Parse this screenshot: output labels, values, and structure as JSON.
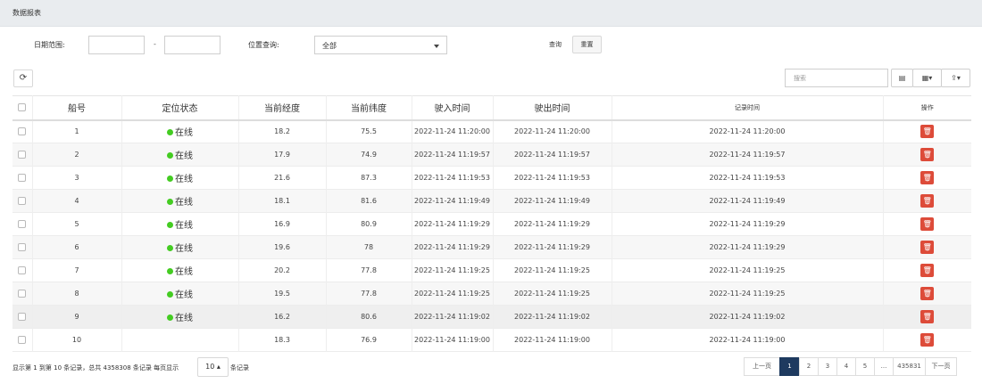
{
  "header": {
    "title": "数据报表"
  },
  "filters": {
    "date_label": "日期范围:",
    "date_start": "",
    "date_end": "",
    "date_separator": "-",
    "position_label": "位置查询:",
    "position_value": "全部",
    "query_label": "查询",
    "reset_label": "重置"
  },
  "toolbar": {
    "search_placeholder": "搜索",
    "refresh_icon": "refresh-icon",
    "toggle_icon": "toggle-view-icon",
    "columns_icon": "columns-grid-icon",
    "export_icon": "export-icon"
  },
  "table": {
    "columns": [
      "船号",
      "定位状态",
      "当前经度",
      "当前纬度",
      "驶入时间",
      "驶出时间",
      "记录时间",
      "操作"
    ],
    "rows": [
      {
        "id": "1",
        "status": "在线",
        "lng": "18.2",
        "lat": "75.5",
        "in": "2022-11-24 11:20:00",
        "out": "2022-11-24 11:20:00",
        "rec": "2022-11-24 11:20:00"
      },
      {
        "id": "2",
        "status": "在线",
        "lng": "17.9",
        "lat": "74.9",
        "in": "2022-11-24 11:19:57",
        "out": "2022-11-24 11:19:57",
        "rec": "2022-11-24 11:19:57"
      },
      {
        "id": "3",
        "status": "在线",
        "lng": "21.6",
        "lat": "87.3",
        "in": "2022-11-24 11:19:53",
        "out": "2022-11-24 11:19:53",
        "rec": "2022-11-24 11:19:53"
      },
      {
        "id": "4",
        "status": "在线",
        "lng": "18.1",
        "lat": "81.6",
        "in": "2022-11-24 11:19:49",
        "out": "2022-11-24 11:19:49",
        "rec": "2022-11-24 11:19:49"
      },
      {
        "id": "5",
        "status": "在线",
        "lng": "16.9",
        "lat": "80.9",
        "in": "2022-11-24 11:19:29",
        "out": "2022-11-24 11:19:29",
        "rec": "2022-11-24 11:19:29"
      },
      {
        "id": "6",
        "status": "在线",
        "lng": "19.6",
        "lat": "78",
        "in": "2022-11-24 11:19:29",
        "out": "2022-11-24 11:19:29",
        "rec": "2022-11-24 11:19:29"
      },
      {
        "id": "7",
        "status": "在线",
        "lng": "20.2",
        "lat": "77.8",
        "in": "2022-11-24 11:19:25",
        "out": "2022-11-24 11:19:25",
        "rec": "2022-11-24 11:19:25"
      },
      {
        "id": "8",
        "status": "在线",
        "lng": "19.5",
        "lat": "77.8",
        "in": "2022-11-24 11:19:25",
        "out": "2022-11-24 11:19:25",
        "rec": "2022-11-24 11:19:25"
      },
      {
        "id": "9",
        "status": "在线",
        "lng": "16.2",
        "lat": "80.6",
        "in": "2022-11-24 11:19:02",
        "out": "2022-11-24 11:19:02",
        "rec": "2022-11-24 11:19:02"
      },
      {
        "id": "10",
        "status": "",
        "lng": "18.3",
        "lat": "76.9",
        "in": "2022-11-24 11:19:00",
        "out": "2022-11-24 11:19:00",
        "rec": "2022-11-24 11:19:00"
      }
    ],
    "delete_icon": "trash-icon",
    "status_color": "#44cc22",
    "delete_color": "#dd4b39"
  },
  "footer": {
    "summary": "显示第 1 到第 10 条记录，总共 4358308 条记录 每页显示",
    "page_size": "10",
    "page_size_suffix": "条记录"
  },
  "pagination": {
    "prev": "上一页",
    "pages": [
      "1",
      "2",
      "3",
      "4",
      "5",
      "...",
      "435831"
    ],
    "current": "1",
    "next": "下一页",
    "active_color": "#1e3a5f"
  }
}
